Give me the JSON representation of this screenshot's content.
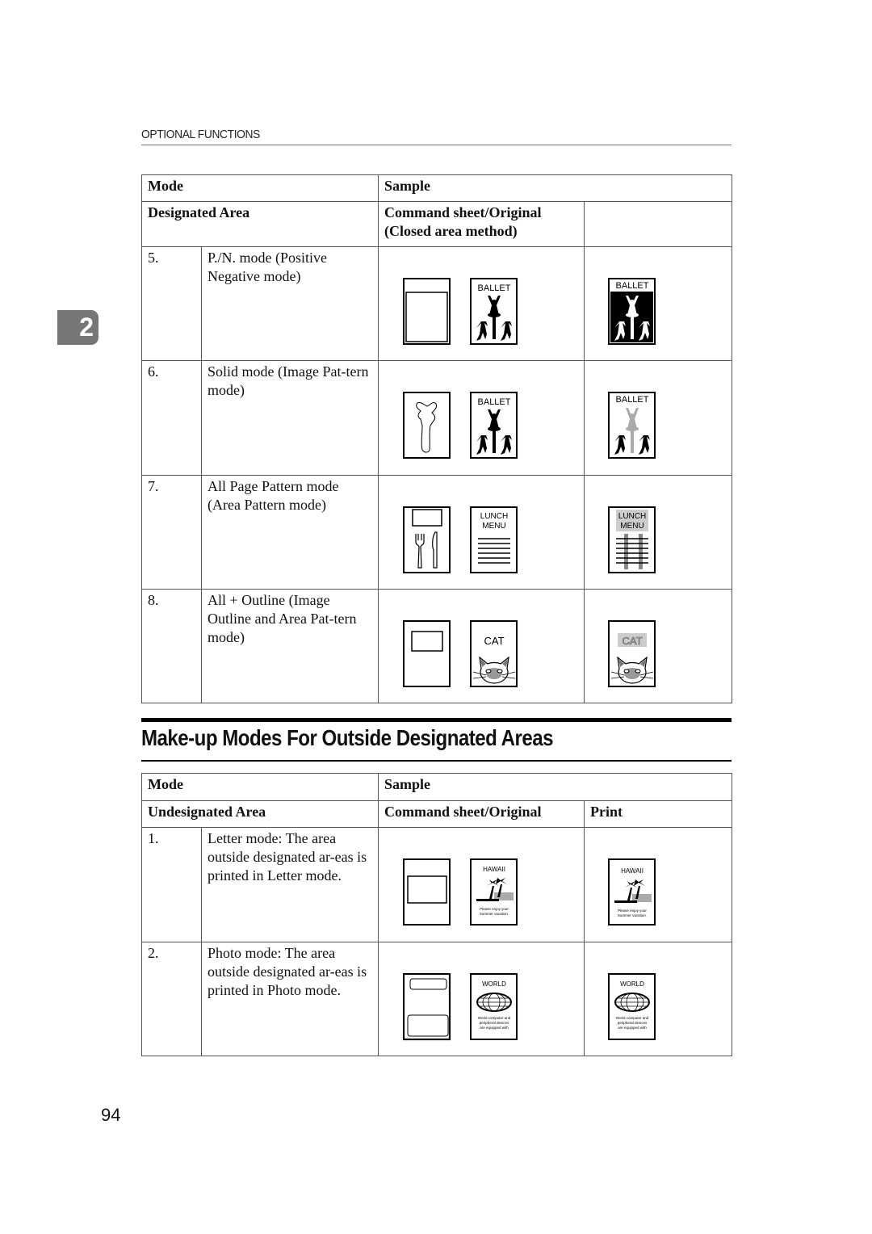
{
  "running_head": "OPTIONAL FUNCTIONS",
  "chapter_tab": "2",
  "table1": {
    "header_row1": {
      "mode": "Mode",
      "sample": "Sample"
    },
    "header_row2": {
      "area": "Designated Area",
      "original": "Command sheet/Original",
      "original_sub": "(Closed area method)",
      "print": ""
    },
    "rows": [
      {
        "num": "5.",
        "desc": "P./N. mode (Positive Negative mode)",
        "original_label": "BALLET",
        "print_label": "BALLET",
        "command_icon": "closed-area-box-icon",
        "original_icon": "ballet-dancers-icon",
        "print_icon": "ballet-dancers-negative-icon"
      },
      {
        "num": "6.",
        "desc": "Solid mode (Image Pat-tern mode)",
        "original_label": "BALLET",
        "print_label": "BALLET",
        "command_icon": "dancer-outline-icon",
        "original_icon": "ballet-dancers-icon",
        "print_icon": "ballet-dancers-patterned-icon"
      },
      {
        "num": "7.",
        "desc": "All Page Pattern mode (Area Pattern mode)",
        "original_label": "LUNCH MENU",
        "print_label": "LUNCH MENU",
        "original_label_l1": "LUNCH",
        "original_label_l2": "MENU",
        "command_icon": "fork-knife-icon",
        "original_icon": "menu-lines-icon",
        "print_icon": "menu-lines-patterned-icon"
      },
      {
        "num": "8.",
        "desc": "All + Outline (Image Outline and Area Pat-tern mode)",
        "original_label": "CAT",
        "print_label": "CAT",
        "command_icon": "area-box-icon",
        "original_icon": "cat-face-icon",
        "print_icon": "cat-face-outlined-icon"
      }
    ]
  },
  "section_title": "Make-up Modes For Outside Designated Areas",
  "table2": {
    "header_row1": {
      "mode": "Mode",
      "sample": "Sample"
    },
    "header_row2": {
      "area": "Undesignated Area",
      "original": "Command sheet/Original",
      "print": "Print"
    },
    "rows": [
      {
        "num": "1.",
        "desc": "Letter mode: The area outside designated ar-eas is printed in Letter mode.",
        "original_label": "HAWAII",
        "caption_l1": "Please enjoy your",
        "caption_l2": "Summer vacation.",
        "command_icon": "area-box-icon",
        "original_icon": "palm-tree-beach-icon",
        "print_icon": "palm-tree-beach-icon"
      },
      {
        "num": "2.",
        "desc": "Photo mode: The area outside designated ar-eas is printed in Photo mode.",
        "original_label": "WORLD",
        "caption_l1": "World computer and",
        "caption_l2": "peripheral devices",
        "caption_l3": "are equipped with",
        "command_icon": "two-area-boxes-icon",
        "original_icon": "globe-icon",
        "print_icon": "globe-icon"
      }
    ]
  },
  "page_number": "94",
  "colors": {
    "tab": "#777777",
    "rule": "#000000",
    "pattern_gray": "#bdbdbd"
  }
}
